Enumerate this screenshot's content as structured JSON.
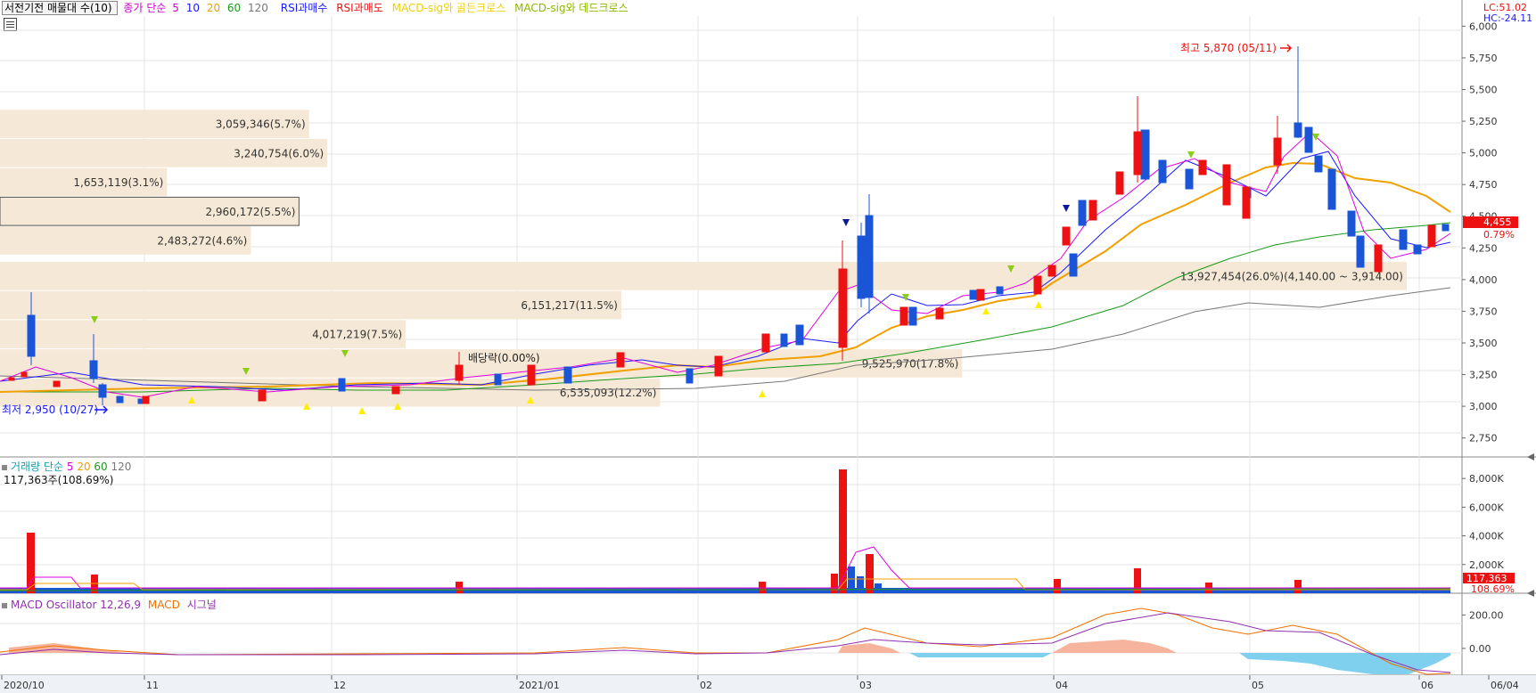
{
  "price_legend": {
    "stock_label": "서전기전 매물대 수(10)",
    "close_label": "종가 단순",
    "ma": [
      {
        "label": "5",
        "color": "#e000e0"
      },
      {
        "label": "10",
        "color": "#1a1aff"
      },
      {
        "label": "20",
        "color": "#f0a000"
      },
      {
        "label": "60",
        "color": "#1a9a1a"
      },
      {
        "label": "120",
        "color": "#777777"
      }
    ],
    "rsi_buy": "RSI과매수",
    "rsi_sell": "RSI과매도",
    "macd_golden": "MACD-sig와 골든크로스",
    "macd_dead": "MACD-sig와 데드크로스"
  },
  "corner": {
    "lc": "LC:51.02",
    "hc": "HC:-24.11"
  },
  "price_axis": {
    "ticks": [
      "6,000",
      "5,750",
      "5,500",
      "5,250",
      "5,000",
      "4,750",
      "4,500",
      "4,250",
      "4,000",
      "3,750",
      "3,500",
      "3,250",
      "3,000",
      "2,750"
    ],
    "current": "4,455",
    "current_pct": "0.79%"
  },
  "annotations": {
    "high": "최고 5,870 (05/11)",
    "low": "최저 2,950 (10/27)",
    "dividend": "배당락(0.00%)"
  },
  "volume_legend": {
    "title": "거래량 단순",
    "ma": [
      {
        "label": "5",
        "color": "#e000e0"
      },
      {
        "label": "20",
        "color": "#f0a000"
      },
      {
        "label": "60",
        "color": "#1a9a1a"
      },
      {
        "label": "120",
        "color": "#777777"
      }
    ],
    "current": "117,363주(108.69%)"
  },
  "volume_axis": {
    "ticks": [
      "8,000K",
      "6,000K",
      "4,000K",
      "2,000K"
    ],
    "current": "117,363",
    "current_pct": "108.69%"
  },
  "macd_legend": {
    "title": "MACD Oscillator 12,26,9",
    "macd": "MACD",
    "signal": "시그널"
  },
  "macd_axis": {
    "ticks": [
      "200.00",
      "0.00"
    ]
  },
  "x_axis": {
    "labels": [
      "2020/10",
      "11",
      "12",
      "2021/01",
      "02",
      "03",
      "04",
      "05",
      "06",
      "06/04"
    ]
  },
  "chart_data": {
    "type": "candlestick",
    "title": "서전기전 매물대 수(10)",
    "x_range": [
      "2020/10",
      "06/04"
    ],
    "price_ylim": [
      2600,
      6080
    ],
    "volume_profile": [
      {
        "label": "3,059,346(5.7%)",
        "price_low": 5110,
        "price_high": 5340,
        "value": 3059346
      },
      {
        "label": "3,240,754(6.0%)",
        "price_low": 4880,
        "price_high": 5110,
        "value": 3240754
      },
      {
        "label": "1,653,119(3.1%)",
        "price_low": 4650,
        "price_high": 4880,
        "value": 1653119
      },
      {
        "label": "2,960,172(5.5%)",
        "price_low": 4420,
        "price_high": 4650,
        "value": 2960172
      },
      {
        "label": "2,483,272(4.6%)",
        "price_low": 4190,
        "price_high": 4420,
        "value": 2483272
      },
      {
        "label": "13,927,454(26.0%)(4,140.00 ~ 3,914.00)",
        "price_low": 3910,
        "price_high": 4140,
        "value": 13927454
      },
      {
        "label": "6,151,217(11.5%)",
        "price_low": 3680,
        "price_high": 3910,
        "value": 6151217
      },
      {
        "label": "4,017,219(7.5%)",
        "price_low": 3450,
        "price_high": 3680,
        "value": 4017219
      },
      {
        "label": "9,525,970(17.8%)",
        "price_low": 3220,
        "price_high": 3450,
        "value": 9525970
      },
      {
        "label": "6,535,093(12.2%)",
        "price_low": 2990,
        "price_high": 3220,
        "value": 6535093
      }
    ],
    "highlighted_band_index": 3,
    "price_high": 5870,
    "price_low": 2950,
    "current_price": 4455,
    "volume_ylim": [
      0,
      9500000
    ],
    "volume_current": 117363,
    "macd_ylim": [
      -160,
      330
    ]
  },
  "colors": {
    "up": "#ee1111",
    "down": "#1a55d8",
    "band": "#f6e8d6",
    "ma5": "#e000e0",
    "ma10": "#1a1aff",
    "ma20": "#f0a000",
    "ma60": "#1a9a1a",
    "ma120": "#777777",
    "macd_pos": "#f7b49c",
    "macd_neg": "#7fd0ee",
    "buy_arrow": "#ffee00",
    "sell_arrow": "#8ccc1a"
  }
}
